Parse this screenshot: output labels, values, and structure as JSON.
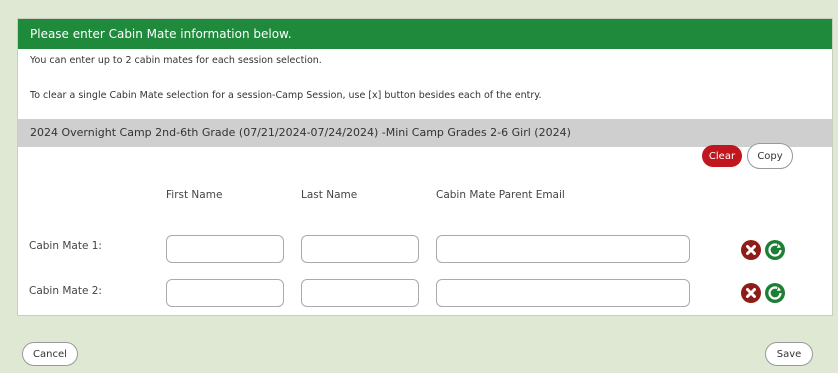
{
  "header": {
    "title": "Please enter Cabin Mate information below."
  },
  "info": {
    "limit_text": "You can enter up to 2 cabin mates for each session selection.",
    "clear_text": "To clear a single Cabin Mate selection for a session-Camp Session, use [x] button besides each of the entry."
  },
  "session": {
    "title": "2024 Overnight Camp 2nd-6th Grade (07/21/2024-07/24/2024) -Mini Camp Grades 2-6 Girl (2024)"
  },
  "actions": {
    "clear_label": "Clear",
    "copy_label": "Copy"
  },
  "columns": {
    "first_name": "First Name",
    "last_name": "Last Name",
    "email": "Cabin Mate Parent Email"
  },
  "rows": [
    {
      "label": "Cabin Mate 1:",
      "first_name": "",
      "last_name": "",
      "email": ""
    },
    {
      "label": "Cabin Mate 2:",
      "first_name": "",
      "last_name": "",
      "email": ""
    }
  ],
  "footer": {
    "cancel_label": "Cancel",
    "save_label": "Save"
  },
  "icons": {
    "clear_row": "close-icon",
    "copy_row": "refresh-icon"
  },
  "colors": {
    "header_bg": "#1f8a3c",
    "clear_btn": "#c0161e",
    "x_icon": "#8f1c16",
    "refresh_icon": "#1d7f36"
  }
}
